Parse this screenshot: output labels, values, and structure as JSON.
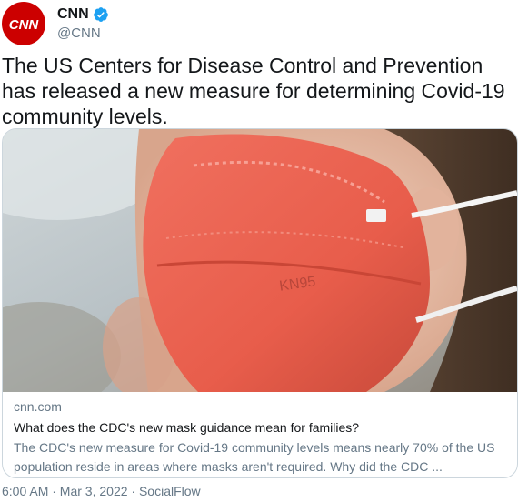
{
  "author": {
    "name": "CNN",
    "handle": "@CNN",
    "avatar_text": "CNN",
    "verified": true,
    "brand_color": "#cc0000",
    "verified_color": "#1da1f2"
  },
  "tweet": {
    "text": "The US Centers for Disease Control and Prevention has released a new measure for determining Covid-19 community levels."
  },
  "card": {
    "image_mask_label": "KN95",
    "domain": "cnn.com",
    "title": "What does the CDC's new mask guidance mean for families?",
    "description": "The CDC's new measure for Covid-19 community levels means nearly 70% of the US population reside in areas where masks aren't required. Why did the CDC ..."
  },
  "meta": {
    "text": "6:00 AM · Mar 3, 2022 · SocialFlow"
  }
}
